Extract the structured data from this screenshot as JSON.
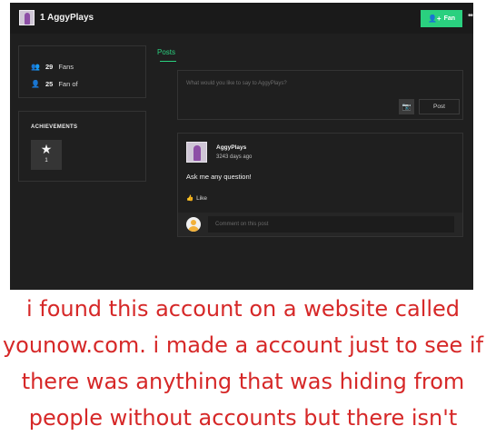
{
  "header": {
    "username": "1 AggyPlays",
    "fan_button_label": "Fan",
    "more_icon": "more-icon"
  },
  "stats": [
    {
      "count": "29",
      "label": "Fans",
      "icon": "fans-icon"
    },
    {
      "count": "25",
      "label": "Fan of",
      "icon": "fan-of-icon"
    }
  ],
  "achievements": {
    "title": "ACHIEVEMENTS",
    "badge_count": "1"
  },
  "tabs": {
    "posts": "Posts"
  },
  "composer": {
    "placeholder": "What would you like to say to AggyPlays?",
    "post_label": "Post"
  },
  "post": {
    "author": "AggyPlays",
    "time": "3243 days ago",
    "body": "Ask me any question!",
    "like_label": "Like",
    "comment_placeholder": "Comment on this post"
  },
  "caption": "i found this account on a website called younow.com. i made a account just to see if there was anything that was hiding from people without accounts but there isn't",
  "colors": {
    "accent": "#2ad07f",
    "background": "#1f1f1f",
    "caption_text": "#d62828"
  }
}
